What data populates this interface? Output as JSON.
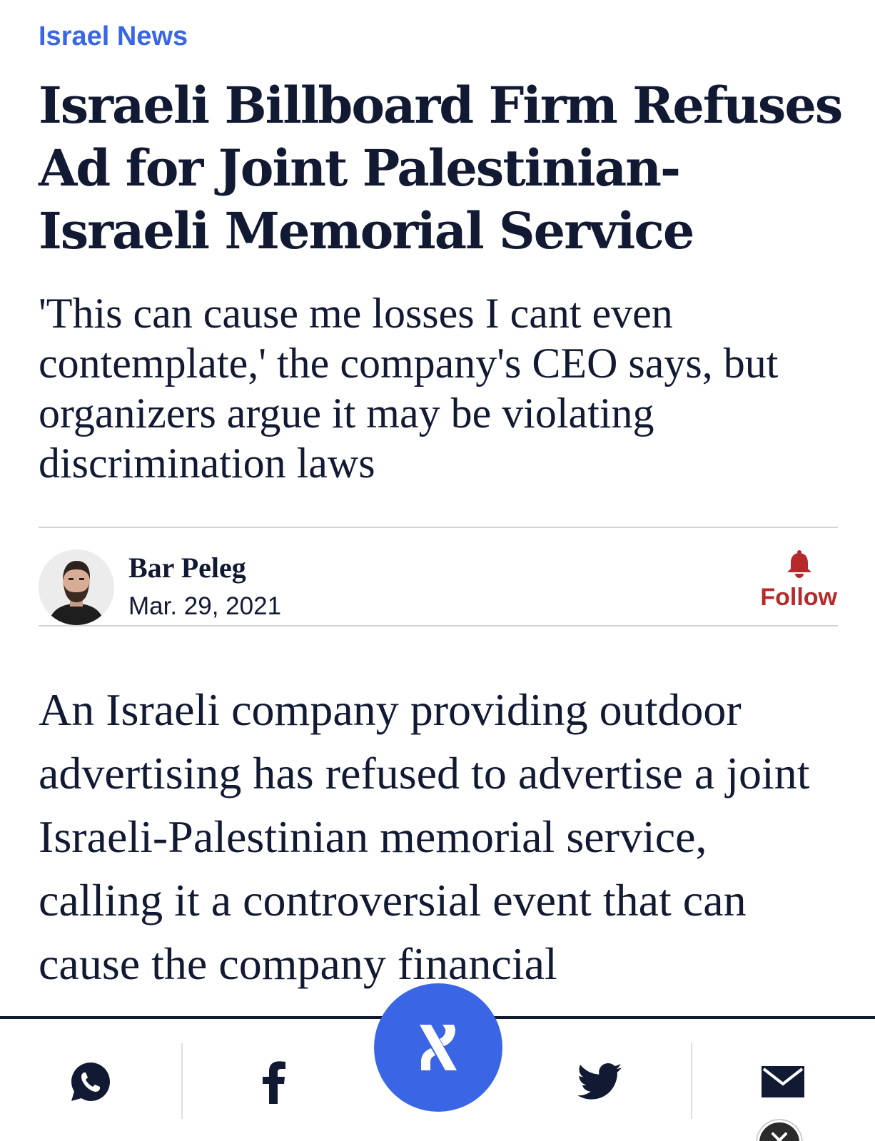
{
  "article": {
    "section": "Israel News",
    "headline": "Israeli Billboard Firm Refuses Ad for Joint Palestinian-Israeli Memorial Service",
    "subheadline": "'This can cause me losses I cant even contemplate,' the company's CEO says, but organizers argue it may be violating discrimination laws",
    "body": "An Israeli company providing outdoor advertising has refused to advertise a joint Israeli-Palestinian memorial service, calling it a controversial event that can cause the company financial"
  },
  "author": {
    "name": "Bar Peleg",
    "date": "Mar. 29, 2021",
    "follow_label": "Follow"
  },
  "share_bar": {
    "items": [
      {
        "icon": "whatsapp-icon"
      },
      {
        "icon": "facebook-icon"
      },
      {
        "icon": "haaretz-logo-icon"
      },
      {
        "icon": "twitter-icon"
      },
      {
        "icon": "email-icon"
      }
    ]
  },
  "colors": {
    "accent": "#3a66e6",
    "text": "#121a33",
    "follow": "#b52a2a"
  }
}
